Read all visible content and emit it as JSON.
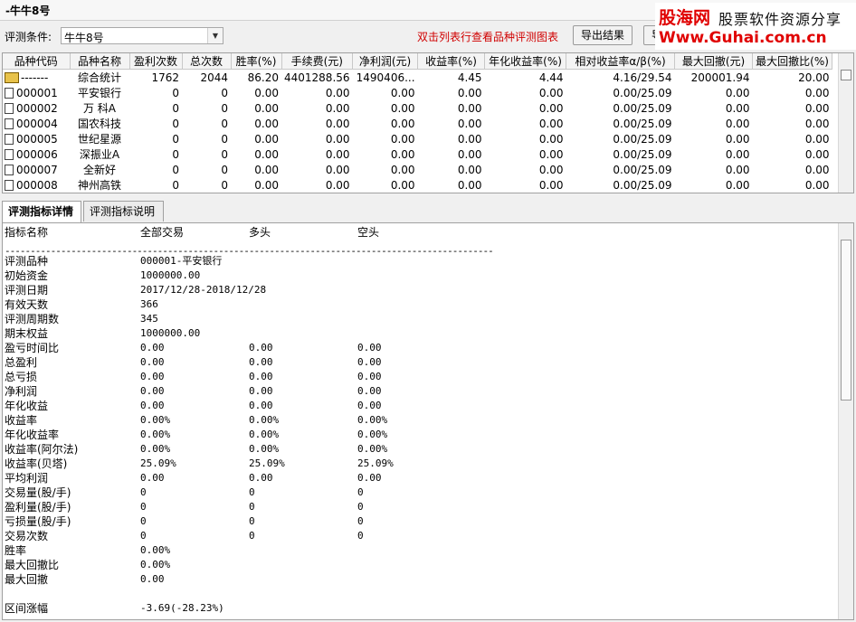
{
  "window": {
    "title": "-牛牛8号"
  },
  "toolbar": {
    "condition_label": "评测条件:",
    "condition_value": "牛牛8号",
    "hint": "双击列表行查看品种评测图表",
    "export_label": "导出结果",
    "btn2_label": "导"
  },
  "watermark": {
    "logo": "股海网",
    "slogan": "股票软件资源分享",
    "url": "Www.Guhai.com.cn"
  },
  "grid": {
    "columns": [
      "品种代码",
      "品种名称",
      "盈利次数",
      "总次数",
      "胜率(%)",
      "手续费(元)",
      "净利润(元)",
      "收益率(%)",
      "年化收益率(%)",
      "相对收益率α/β(%)",
      "最大回撤(元)",
      "最大回撤比(%)"
    ],
    "rows": [
      {
        "code": "-------",
        "name": "综合统计",
        "win": "1762",
        "total": "2044",
        "rate": "86.20",
        "fee": "4401288.56",
        "profit": "1490406...",
        "ret": "4.45",
        "annual": "4.44",
        "alpha": "4.16/29.54",
        "maxdd": "200001.94",
        "ddratio": "20.00",
        "summary": true
      },
      {
        "code": "000001",
        "name": "平安银行",
        "win": "0",
        "total": "0",
        "rate": "0.00",
        "fee": "0.00",
        "profit": "0.00",
        "ret": "0.00",
        "annual": "0.00",
        "alpha": "0.00/25.09",
        "maxdd": "0.00",
        "ddratio": "0.00"
      },
      {
        "code": "000002",
        "name": "万 科A",
        "win": "0",
        "total": "0",
        "rate": "0.00",
        "fee": "0.00",
        "profit": "0.00",
        "ret": "0.00",
        "annual": "0.00",
        "alpha": "0.00/25.09",
        "maxdd": "0.00",
        "ddratio": "0.00"
      },
      {
        "code": "000004",
        "name": "国农科技",
        "win": "0",
        "total": "0",
        "rate": "0.00",
        "fee": "0.00",
        "profit": "0.00",
        "ret": "0.00",
        "annual": "0.00",
        "alpha": "0.00/25.09",
        "maxdd": "0.00",
        "ddratio": "0.00"
      },
      {
        "code": "000005",
        "name": "世纪星源",
        "win": "0",
        "total": "0",
        "rate": "0.00",
        "fee": "0.00",
        "profit": "0.00",
        "ret": "0.00",
        "annual": "0.00",
        "alpha": "0.00/25.09",
        "maxdd": "0.00",
        "ddratio": "0.00"
      },
      {
        "code": "000006",
        "name": "深振业A",
        "win": "0",
        "total": "0",
        "rate": "0.00",
        "fee": "0.00",
        "profit": "0.00",
        "ret": "0.00",
        "annual": "0.00",
        "alpha": "0.00/25.09",
        "maxdd": "0.00",
        "ddratio": "0.00"
      },
      {
        "code": "000007",
        "name": "全新好",
        "win": "0",
        "total": "0",
        "rate": "0.00",
        "fee": "0.00",
        "profit": "0.00",
        "ret": "0.00",
        "annual": "0.00",
        "alpha": "0.00/25.09",
        "maxdd": "0.00",
        "ddratio": "0.00"
      },
      {
        "code": "000008",
        "name": "神州高铁",
        "win": "0",
        "total": "0",
        "rate": "0.00",
        "fee": "0.00",
        "profit": "0.00",
        "ret": "0.00",
        "annual": "0.00",
        "alpha": "0.00/25.09",
        "maxdd": "0.00",
        "ddratio": "0.00"
      }
    ]
  },
  "tabs": [
    "评测指标详情",
    "评测指标说明"
  ],
  "detail": {
    "header": [
      "指标名称",
      "全部交易",
      "多头",
      "空头"
    ],
    "separator": "------------------------------------------------------------------------------------------------",
    "lines": [
      [
        "评测品种",
        "000001-平安银行",
        "",
        ""
      ],
      [
        "初始资金",
        "1000000.00",
        "",
        ""
      ],
      [
        "评测日期",
        "2017/12/28-2018/12/28",
        "",
        ""
      ],
      [
        "有效天数",
        "366",
        "",
        ""
      ],
      [
        "评测周期数",
        "345",
        "",
        ""
      ],
      [
        "期末权益",
        "1000000.00",
        "",
        ""
      ],
      [
        "盈亏时间比",
        "0.00",
        "0.00",
        "0.00"
      ],
      [
        "总盈利",
        "0.00",
        "0.00",
        "0.00"
      ],
      [
        "总亏损",
        "0.00",
        "0.00",
        "0.00"
      ],
      [
        "净利润",
        "0.00",
        "0.00",
        "0.00"
      ],
      [
        "年化收益",
        "0.00",
        "0.00",
        "0.00"
      ],
      [
        "收益率",
        "0.00%",
        "0.00%",
        "0.00%"
      ],
      [
        "年化收益率",
        "0.00%",
        "0.00%",
        "0.00%"
      ],
      [
        "收益率(阿尔法)",
        "0.00%",
        "0.00%",
        "0.00%"
      ],
      [
        "收益率(贝塔)",
        "25.09%",
        "25.09%",
        "25.09%"
      ],
      [
        "平均利润",
        "0.00",
        "0.00",
        "0.00"
      ],
      [
        "交易量(股/手)",
        "0",
        "0",
        "0"
      ],
      [
        "盈利量(股/手)",
        "0",
        "0",
        "0"
      ],
      [
        "亏损量(股/手)",
        "0",
        "0",
        "0"
      ],
      [
        "交易次数",
        "0",
        "0",
        "0"
      ],
      [
        "胜率",
        "0.00%",
        "",
        ""
      ],
      [
        "最大回撤比",
        "0.00%",
        "",
        ""
      ],
      [
        "最大回撤",
        "0.00",
        "",
        ""
      ],
      [
        "",
        "",
        "",
        ""
      ],
      [
        "区间涨幅",
        "-3.69(-28.23%)",
        "",
        ""
      ]
    ]
  }
}
